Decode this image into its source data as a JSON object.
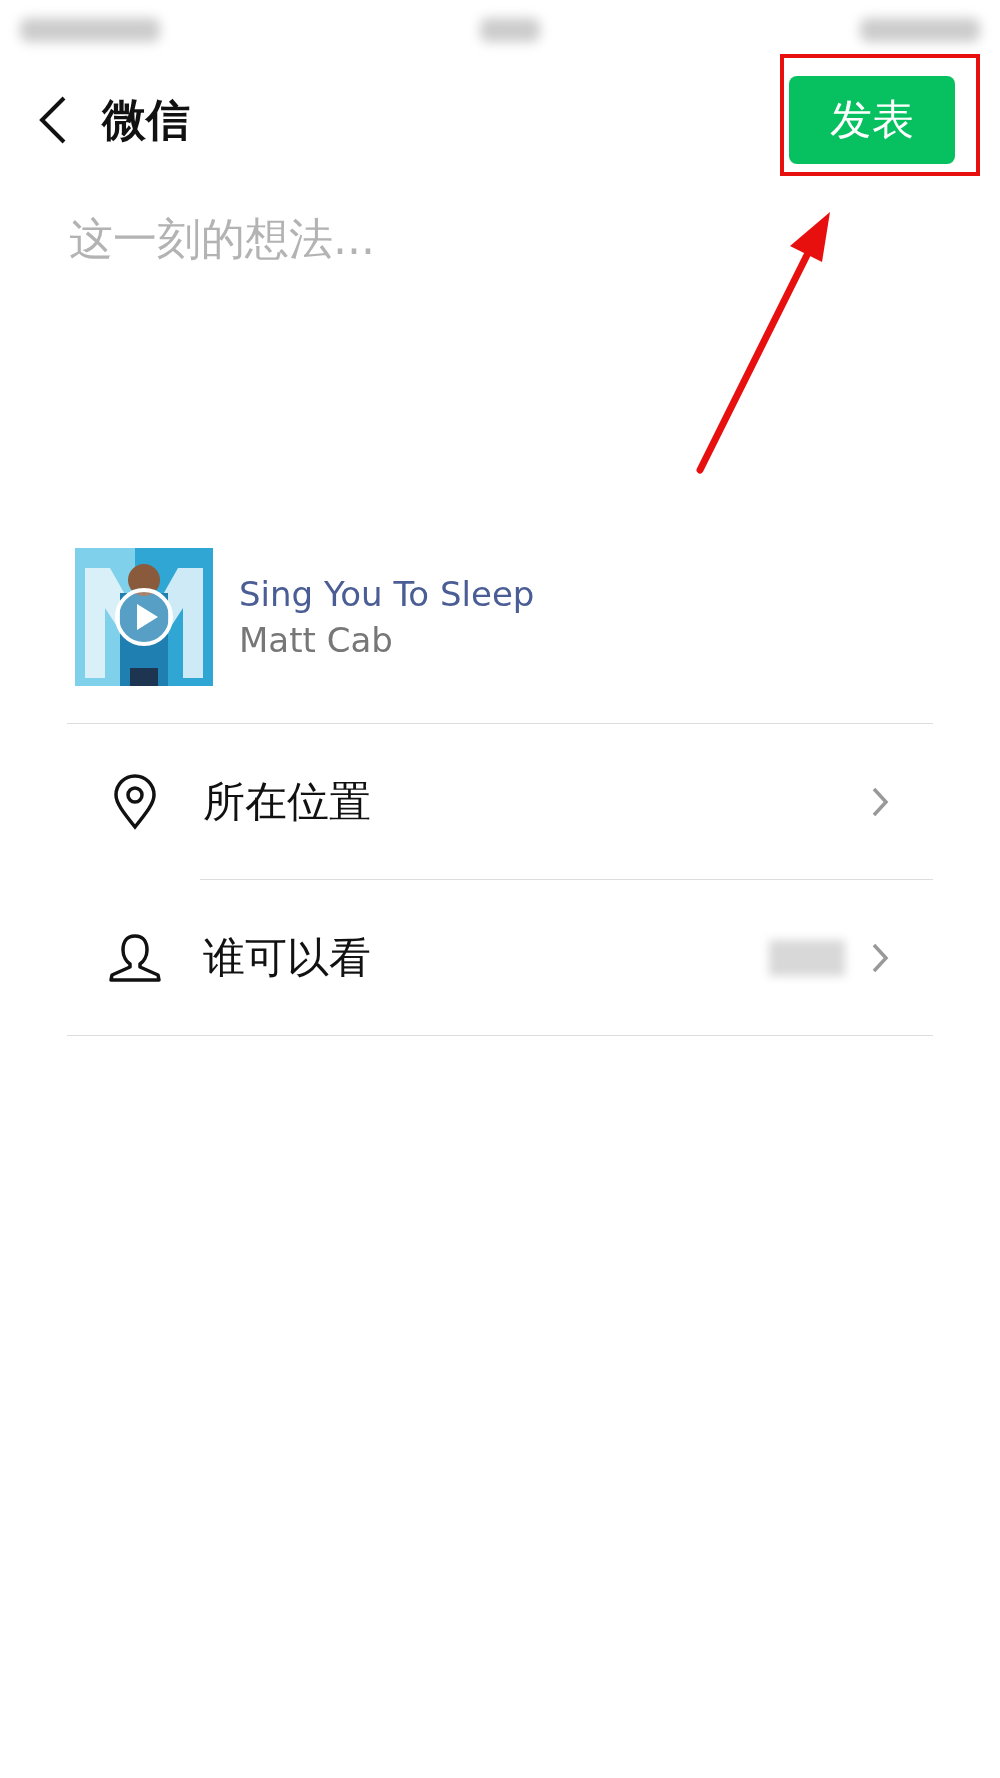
{
  "header": {
    "title": "微信",
    "publish_button": "发表"
  },
  "composer": {
    "placeholder": "这一刻的想法..."
  },
  "music": {
    "title": "Sing You To Sleep",
    "artist": "Matt Cab"
  },
  "options": [
    {
      "kind": "location",
      "label": "所在位置"
    },
    {
      "kind": "audience",
      "label": "谁可以看"
    }
  ]
}
